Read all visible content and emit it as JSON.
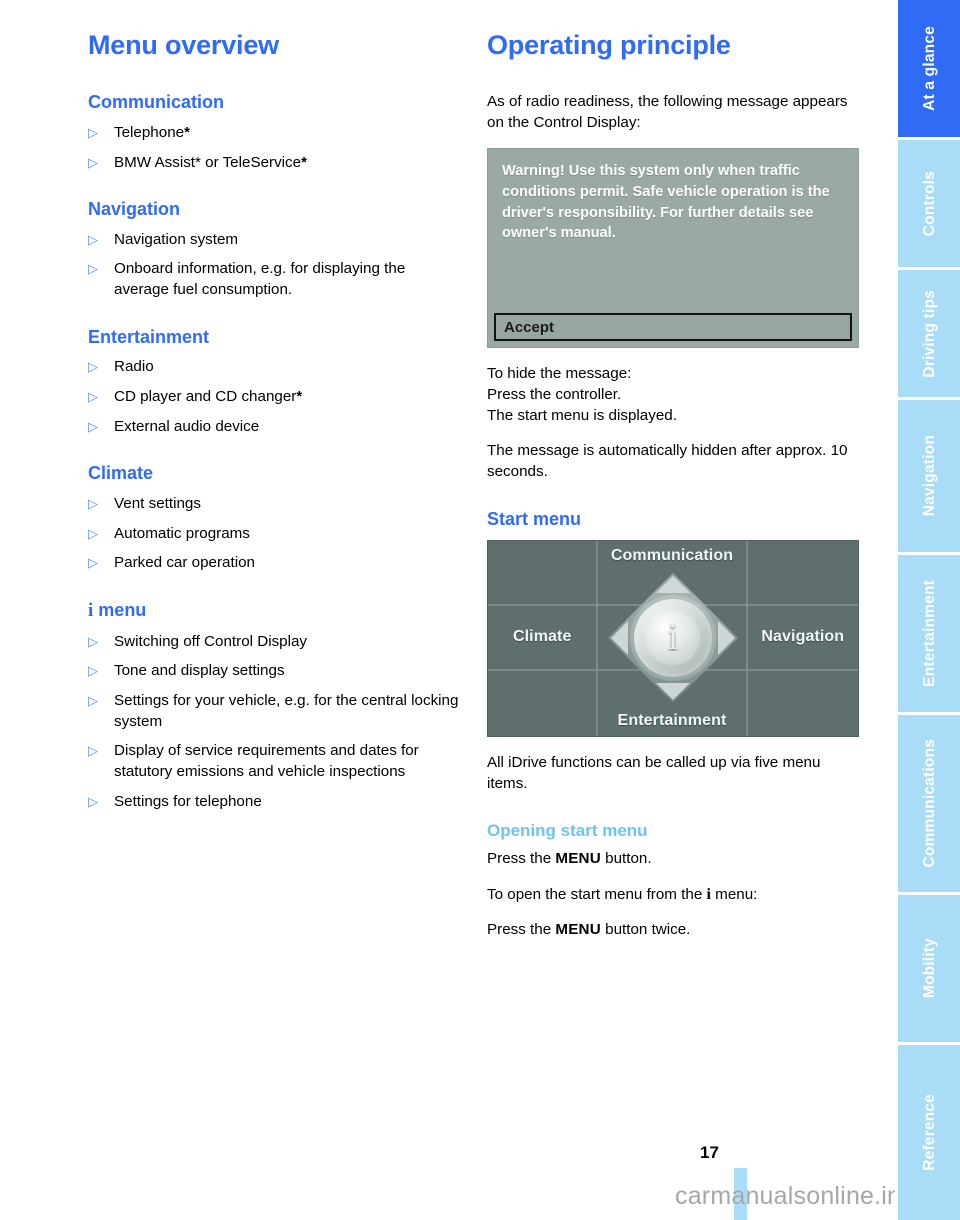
{
  "page": {
    "number": "17",
    "watermark": "carmanualsonline.info"
  },
  "sidebar": {
    "tabs": [
      {
        "label": "At a glance",
        "active": true
      },
      {
        "label": "Controls",
        "active": false
      },
      {
        "label": "Driving tips",
        "active": false
      },
      {
        "label": "Navigation",
        "active": false
      },
      {
        "label": "Entertainment",
        "active": false
      },
      {
        "label": "Communications",
        "active": false
      },
      {
        "label": "Mobility",
        "active": false
      },
      {
        "label": "Reference",
        "active": false
      }
    ]
  },
  "left_column": {
    "title": "Menu overview",
    "sections": [
      {
        "heading": "Communication",
        "items": [
          {
            "text": "Telephone",
            "star": "*"
          },
          {
            "text": "BMW Assist* or TeleService",
            "star": "*"
          }
        ]
      },
      {
        "heading": "Navigation",
        "items": [
          {
            "text": "Navigation system",
            "star": ""
          },
          {
            "text": "Onboard information, e.g. for displaying the average fuel consumption.",
            "star": ""
          }
        ]
      },
      {
        "heading": "Entertainment",
        "items": [
          {
            "text": "Radio",
            "star": ""
          },
          {
            "text": "CD player and CD changer",
            "star": "*"
          },
          {
            "text": "External audio device",
            "star": ""
          }
        ]
      },
      {
        "heading": "Climate",
        "items": [
          {
            "text": "Vent settings",
            "star": ""
          },
          {
            "text": "Automatic programs",
            "star": ""
          },
          {
            "text": "Parked car operation",
            "star": ""
          }
        ]
      },
      {
        "heading": "menu",
        "heading_prefix_icon": "i",
        "items": [
          {
            "text": "Switching off Control Display",
            "star": ""
          },
          {
            "text": "Tone and display settings",
            "star": ""
          },
          {
            "text": "Settings for your vehicle, e.g. for the central locking system",
            "star": ""
          },
          {
            "text": "Display of service requirements and dates for statutory emissions and vehicle inspections",
            "star": ""
          },
          {
            "text": "Settings for telephone",
            "star": ""
          }
        ]
      }
    ],
    "bullet_glyph": "▷"
  },
  "right_column": {
    "title": "Operating principle",
    "intro": "As of radio readiness, the following message appears on the Control Display:",
    "warning_screen": {
      "message": "Warning! Use this system only when traffic conditions permit. Safe vehicle operation is the driver's responsibility. For further details see owner's manual.",
      "button_label": "Accept"
    },
    "hide_lines": [
      "To hide the message:",
      "Press the controller.",
      "The start menu is displayed."
    ],
    "auto_hide": "The message is automatically hidden after approx. 10 seconds.",
    "start_menu_heading": "Start menu",
    "start_menu_screen": {
      "top": "Communication",
      "left": "Climate",
      "right": "Navigation",
      "bottom": "Entertainment",
      "center_icon": "i"
    },
    "idrive_note": "All iDrive functions can be called up via five menu items.",
    "opening_heading": "Opening start menu",
    "opening_steps": [
      {
        "before": "Press the ",
        "key": "MENU",
        "after": " button."
      },
      {
        "before": "To open the start menu from the ",
        "key": "",
        "after": " menu:",
        "icon": "i"
      },
      {
        "before": "Press the ",
        "key": "MENU",
        "after": " button twice."
      }
    ]
  },
  "colors": {
    "heading_blue": "#2f6bf5",
    "subheading_blue": "#6fc3ef",
    "tab_light": "#a9ddf7",
    "tab_active": "#2f6bf5",
    "screen_warning_bg": "#9aa9a6",
    "screen_menu_bg": "#5e6f6e"
  }
}
